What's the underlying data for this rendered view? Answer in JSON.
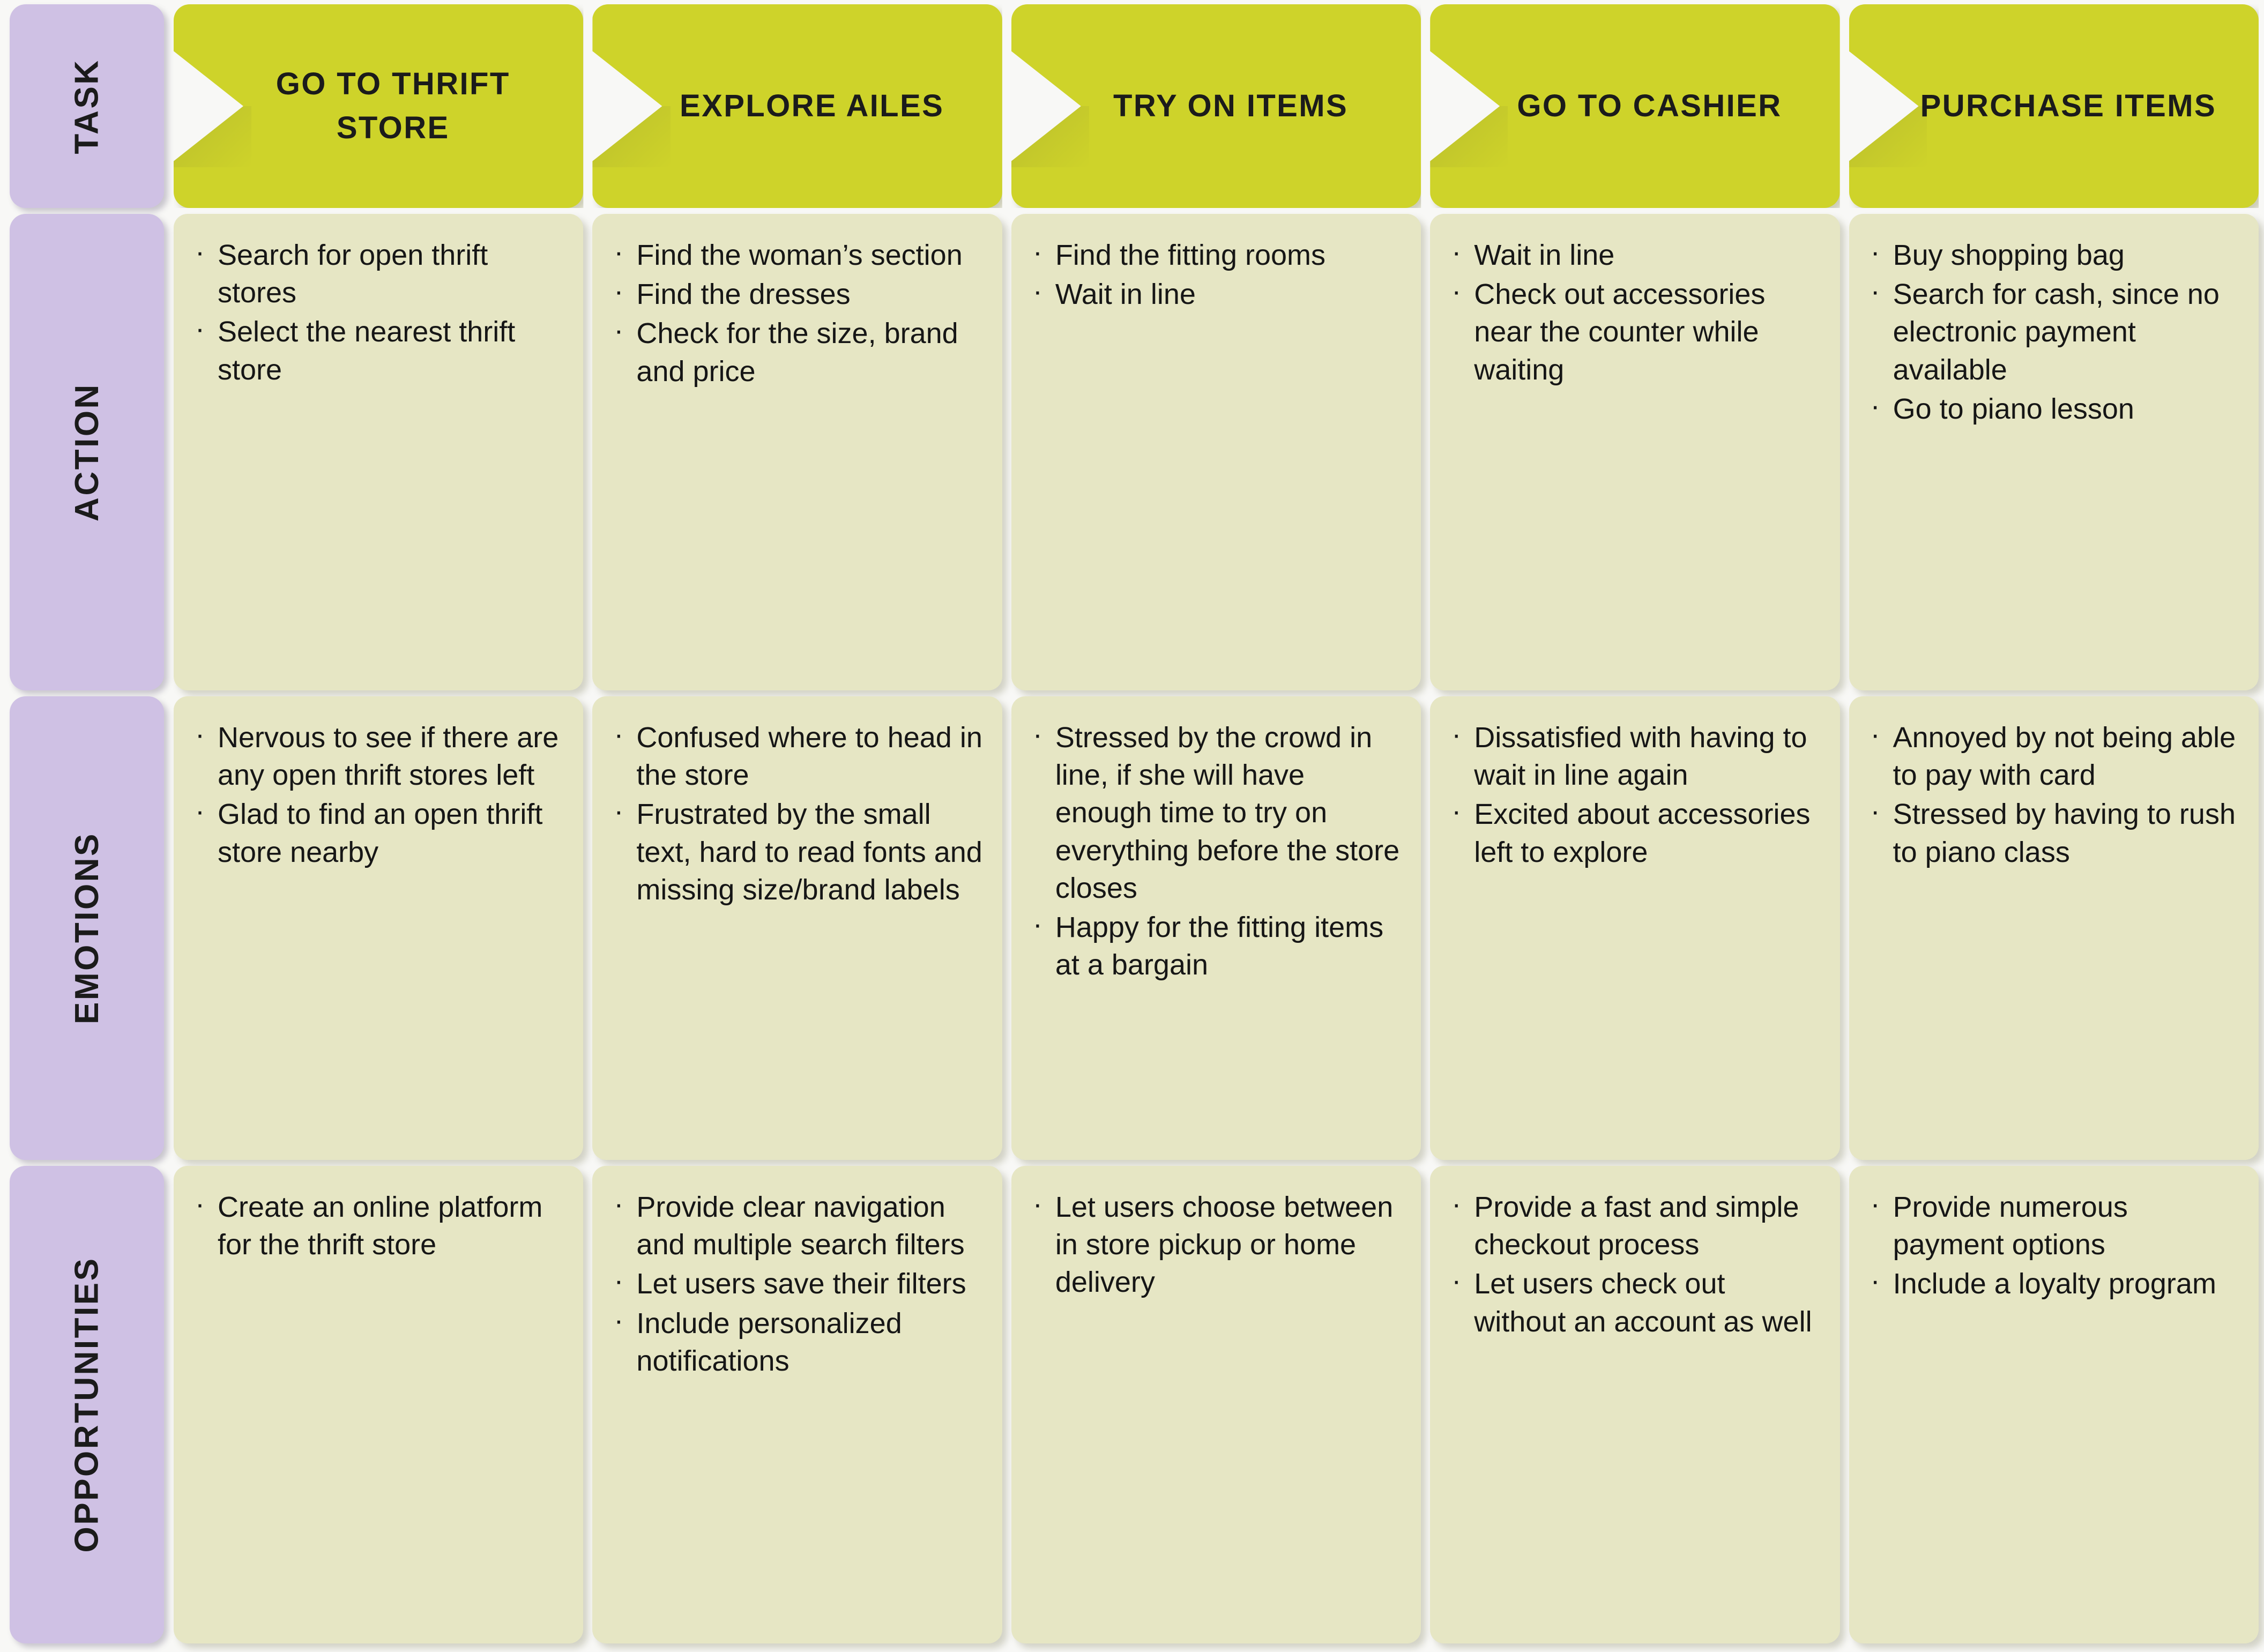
{
  "map": {
    "title": "Thrift Store User Journey Map",
    "colors": {
      "background": "#f8f8f6",
      "task_card": "#ced32a",
      "label_card": "#cfc1e4",
      "content_card": "#e6e6c4",
      "text": "#1b1b1b"
    }
  },
  "rows": {
    "task": {
      "label": "TASK",
      "cards": [
        {
          "title": "GO TO THRIFT STORE"
        },
        {
          "title": "EXPLORE AILES"
        },
        {
          "title": "TRY ON ITEMS"
        },
        {
          "title": "GO TO CASHIER"
        },
        {
          "title": "PURCHASE ITEMS"
        }
      ]
    },
    "action": {
      "label": "ACTION",
      "cells": [
        {
          "items": [
            "Search for open thrift stores",
            "Select the nearest thrift store"
          ]
        },
        {
          "items": [
            "Find the woman’s section",
            "Find the dresses",
            "Check for the size, brand and price"
          ]
        },
        {
          "items": [
            "Find the fitting rooms",
            "Wait in line"
          ]
        },
        {
          "items": [
            "Wait in line",
            "Check out accessories near the counter while waiting"
          ]
        },
        {
          "items": [
            "Buy shopping bag",
            "Search for cash, since no electronic payment available",
            "Go to piano lesson"
          ]
        }
      ]
    },
    "emotions": {
      "label": "EMOTIONS",
      "cells": [
        {
          "items": [
            "Nervous to see if there are any open thrift stores left",
            "Glad to find an open thrift store nearby"
          ]
        },
        {
          "items": [
            "Confused where to head in the store",
            "Frustrated by the small text, hard to read fonts and missing size/brand labels"
          ]
        },
        {
          "items": [
            "Stressed by the crowd in line, if she will have enough time to try on everything before the store closes",
            "Happy for the fitting items at a bargain"
          ]
        },
        {
          "items": [
            "Dissatisfied with having to wait in line again",
            "Excited about accessories left to explore"
          ]
        },
        {
          "items": [
            "Annoyed by not being able to pay with card",
            "Stressed by having to rush to piano class"
          ]
        }
      ]
    },
    "opportunities": {
      "label": "OPPORTUNITIES",
      "cells": [
        {
          "items": [
            "Create an online platform for the thrift store"
          ]
        },
        {
          "items": [
            "Provide clear navigation and multiple search filters",
            "Let users save their filters",
            "Include personalized notifications"
          ]
        },
        {
          "items": [
            "Let users choose between in store pickup or home delivery"
          ]
        },
        {
          "items": [
            "Provide a fast and simple checkout process",
            "Let users check out without an account as well"
          ]
        },
        {
          "items": [
            "Provide numerous payment options",
            "Include a loyalty program"
          ]
        }
      ]
    }
  }
}
